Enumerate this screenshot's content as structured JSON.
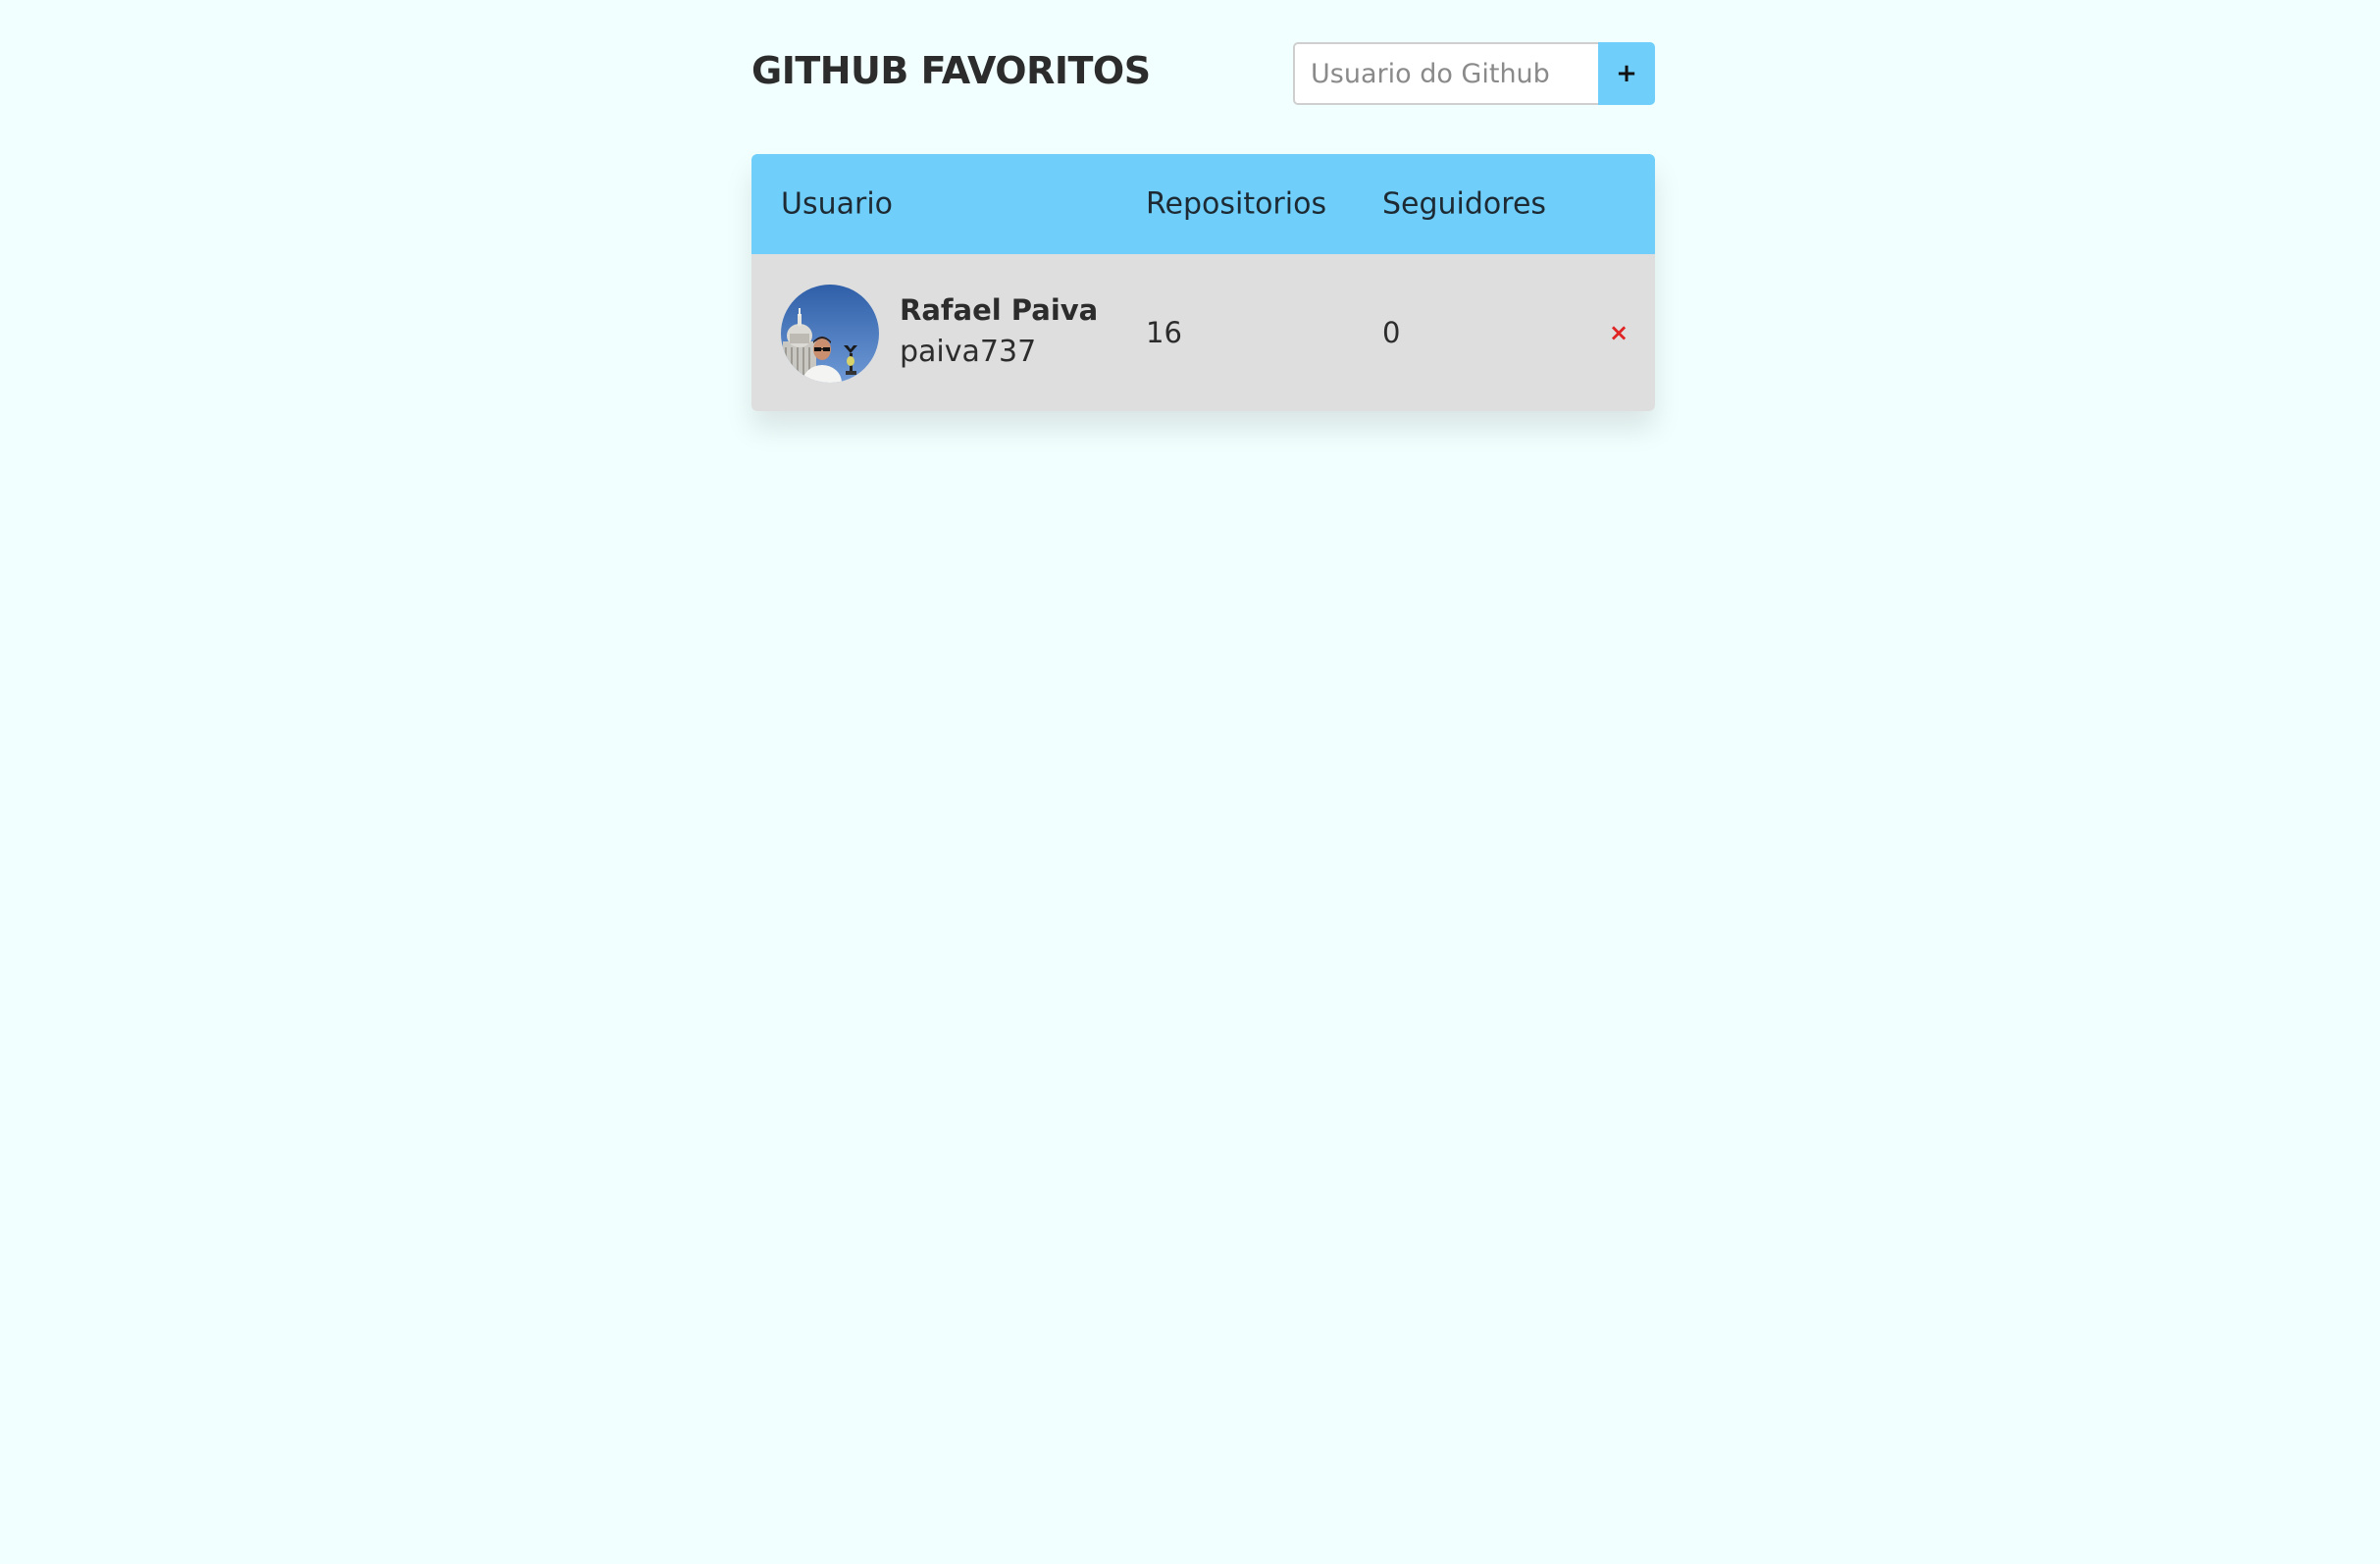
{
  "header": {
    "title": "GITHUB FAVORITOS",
    "search_placeholder": "Usuario do Github",
    "search_value": "",
    "add_label": "+"
  },
  "table": {
    "columns": [
      "Usuario",
      "Repositorios",
      "Seguidores"
    ],
    "rows": [
      {
        "name": "Rafael Paiva",
        "login": "paiva737",
        "repositories": "16",
        "followers": "0",
        "remove_label": "×",
        "avatar_icon": "user-avatar-photo"
      }
    ]
  },
  "colors": {
    "background": "#f1fffe",
    "accent": "#6fcffa",
    "row_background": "#dedede",
    "remove": "#e02424",
    "text": "#2c2c2c"
  }
}
